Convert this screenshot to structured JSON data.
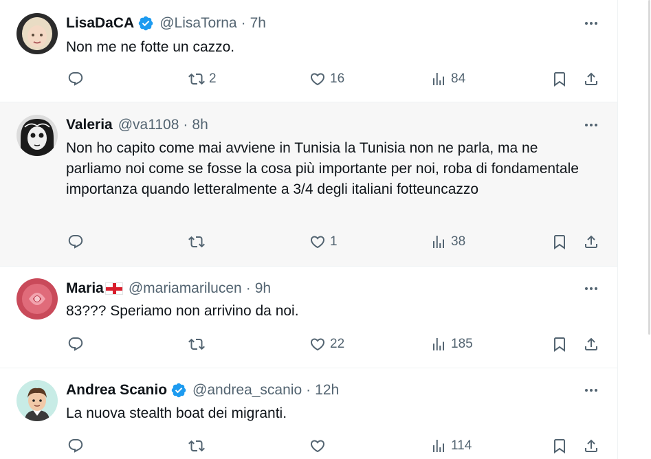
{
  "icons": {
    "reply": "reply-bubble-icon",
    "retweet": "retweet-icon",
    "like": "heart-icon",
    "views": "views-bar-chart-icon",
    "bookmark": "bookmark-icon",
    "share": "share-upload-icon",
    "more": "more-dots-icon",
    "verified": "verified-badge-icon",
    "flag": "england-flag-icon"
  },
  "colors": {
    "text": "#0f1419",
    "muted": "#536471",
    "verified": "#1d9bf0",
    "highlight_bg": "#f7f7f7"
  },
  "tweets": [
    {
      "name": "LisaDaCA",
      "handle": "@LisaTorna",
      "dot": "·",
      "time": "7h",
      "text": "Non me ne fotte un cazzo.",
      "replies": "",
      "retweets": "2",
      "likes": "16",
      "views": "84"
    },
    {
      "name": "Valeria",
      "handle": "@va1108",
      "dot": "·",
      "time": "8h",
      "text": "Non ho capito come mai avviene in Tunisia la Tunisia non ne parla, ma ne parliamo noi come se fosse la cosa più importante per noi, roba di fondamentale importanza quando letteralmente a 3/4 degli italiani fotteuncazzo",
      "replies": "",
      "retweets": "",
      "likes": "1",
      "views": "38"
    },
    {
      "name": "Maria",
      "handle": "@mariamarilucen",
      "dot": "·",
      "time": "9h",
      "text": "83??? Speriamo non arrivino da noi.",
      "replies": "",
      "retweets": "",
      "likes": "22",
      "views": "185"
    },
    {
      "name": "Andrea Scanio",
      "handle": "@andrea_scanio",
      "dot": "·",
      "time": "12h",
      "text": "La nuova stealth boat dei migranti.",
      "replies": "",
      "retweets": "",
      "likes": "",
      "views": "114"
    }
  ]
}
